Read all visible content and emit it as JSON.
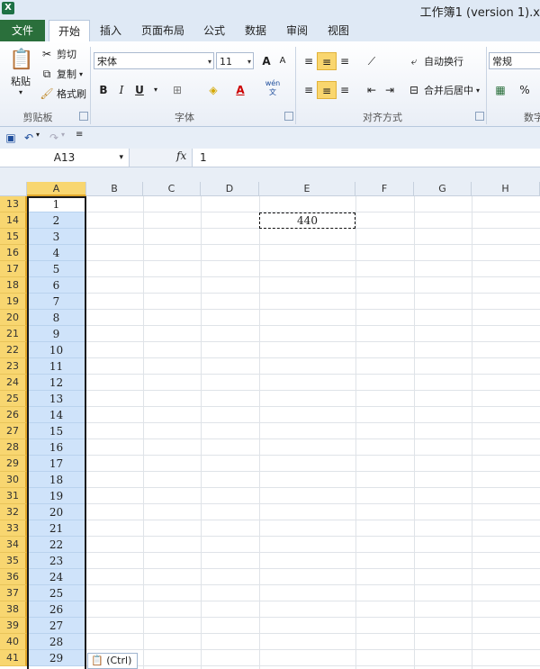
{
  "window": {
    "title": "工作簿1 (version 1).x",
    "app_icon": "excel-logo-icon",
    "logo_text": "X"
  },
  "tabs": [
    {
      "label": "文件"
    },
    {
      "label": "开始"
    },
    {
      "label": "插入"
    },
    {
      "label": "页面布局"
    },
    {
      "label": "公式"
    },
    {
      "label": "数据"
    },
    {
      "label": "审阅"
    },
    {
      "label": "视图"
    }
  ],
  "ribbon": {
    "clipboard": {
      "paste": "粘贴",
      "cut": "剪切",
      "copy": "复制",
      "format_painter": "格式刷",
      "group": "剪贴板"
    },
    "font": {
      "name": "宋体",
      "size": "11",
      "bold": "B",
      "italic": "I",
      "underline": "U",
      "group": "字体",
      "grow": "A",
      "shrink": "A",
      "wen": "wén",
      "wen_char": "文"
    },
    "alignment": {
      "wrap": "自动换行",
      "merge": "合并后居中",
      "group": "对齐方式"
    },
    "number": {
      "format": "常规",
      "percent": "%",
      "group": "数字"
    }
  },
  "formula_bar": {
    "name_box": "A13",
    "fx": "fx",
    "value": "1"
  },
  "columns": [
    "A",
    "B",
    "C",
    "D",
    "E",
    "F",
    "G",
    "H"
  ],
  "rows": [
    {
      "num": "13",
      "a": "1"
    },
    {
      "num": "14",
      "a": "2"
    },
    {
      "num": "15",
      "a": "3"
    },
    {
      "num": "16",
      "a": "4"
    },
    {
      "num": "17",
      "a": "5"
    },
    {
      "num": "18",
      "a": "6"
    },
    {
      "num": "19",
      "a": "7"
    },
    {
      "num": "20",
      "a": "8"
    },
    {
      "num": "21",
      "a": "9"
    },
    {
      "num": "22",
      "a": "10"
    },
    {
      "num": "23",
      "a": "11"
    },
    {
      "num": "24",
      "a": "12"
    },
    {
      "num": "25",
      "a": "13"
    },
    {
      "num": "26",
      "a": "14"
    },
    {
      "num": "27",
      "a": "15"
    },
    {
      "num": "28",
      "a": "16"
    },
    {
      "num": "29",
      "a": "17"
    },
    {
      "num": "30",
      "a": "18"
    },
    {
      "num": "31",
      "a": "19"
    },
    {
      "num": "32",
      "a": "20"
    },
    {
      "num": "33",
      "a": "21"
    },
    {
      "num": "34",
      "a": "22"
    },
    {
      "num": "35",
      "a": "23"
    },
    {
      "num": "36",
      "a": "24"
    },
    {
      "num": "37",
      "a": "25"
    },
    {
      "num": "38",
      "a": "26"
    },
    {
      "num": "39",
      "a": "27"
    },
    {
      "num": "40",
      "a": "28"
    },
    {
      "num": "41",
      "a": "29"
    }
  ],
  "copied_cell": {
    "value": "440"
  },
  "paste_options": {
    "label": "(Ctrl)"
  },
  "colors": {
    "file_tab": "#2a6f3b",
    "selected_header": "#f8d670",
    "selection_fill": "#cfe3fa"
  }
}
